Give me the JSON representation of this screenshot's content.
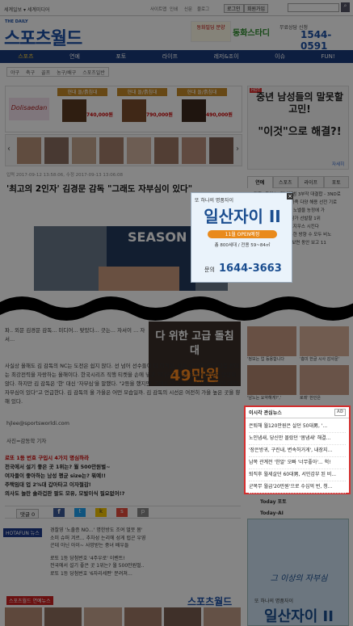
{
  "topbar": {
    "left": "세계일보 ▾ 세계미디어",
    "links": [
      "사이트맵",
      "인쇄",
      "신문",
      "블로그"
    ],
    "login": "로그인",
    "join": "회원가입",
    "search_placeholder": ""
  },
  "header": {
    "logo": "스포츠월드",
    "sub": "THE DAILY",
    "ad1": "동화빌딩 분양",
    "ad2": "동화스타디",
    "phone": "1544-0591",
    "phone_label": "무료상담 신청"
  },
  "nav": {
    "items": [
      "스포츠",
      "연예",
      "포토",
      "라이프",
      "레저&조이",
      "이슈",
      "FUN!"
    ],
    "active": 0
  },
  "subnav": [
    "야구",
    "축구",
    "골프",
    "농구/배구",
    "스포츠일반"
  ],
  "ads": {
    "bed_prices": [
      "740,000원",
      "790,000원",
      "490,000원"
    ],
    "bed_title": "현대 돌/흙침대",
    "right_ad_title": "중년 남성들의 말못할 고민!",
    "right_ad_sub": "\"이것\"으로 해결?!",
    "right_ad_link": "자세히"
  },
  "article": {
    "date": "입력 2017-09-12 13:58:06, 수정 2017-09-13 13:06:08",
    "title": "'최고의 2인자' 김경문 감독 \"그래도 자부심이 있다\"",
    "body1": "파.. 외문 김경문 감독... 미디어... 맞았다... 긋는... 자서이 ... 자서...",
    "body2": "사실상 올해도 김 감독의 NC는 도전은 쉽지 않다. 선 넘어 선수들이 다 이겨고, 비롱, 거인에 이어 다음 상대는 최강전력을 자랑하는 올해이다. 한국시리즈 직행 티켓을 손에 넣고 기다리고 있는 호랑이 군단도 만만치 않다. 하지만 김 감독은 '한' 대신 '자부심'을 말했다. \"2등을 했지만, 그래도 마음속 한 구석에는 (이에 대한) 자부심이 있다\"고 언급한다. 김 감독의 올 가을은 어떤 모습일까. 김 감독의 시선은 여전히 가을 높은 곳을 향해 있다.",
    "email": "hjlee@sportsworldi.com",
    "photo": "사진=감동학 기자",
    "promo_lines": [
      "로또 1등 번호 구입시 4가지 명심하라",
      "전국에서 설기 좋은 곳 1위는? 월 500만원벌~",
      "여자들이 좋아하는 남성 평균 size는? 뭐예!!",
      "주택임대 업 2%대 갑아타고 이자절감!",
      "의사도 놀란 솔라겁판 팔도 모유, 모발이식 필요없어!?"
    ],
    "comment": "댓글",
    "comment_count": "0",
    "center_ad_text": "다 위한 고급 돌침대",
    "center_ad_price": "49만원"
  },
  "hotafun": {
    "label": "HOTAFUN 뉴스",
    "items": [
      "경찰영 '노출증 NO…' 명한방도 조여 멀뭇 봄'",
      "소미 슈퍼 겨르... 추차성 는리에 성게 럽곤 우영",
      "곤데 아닌 아이~ 사망받는 중녀 배우들",
      "로또 1등 당첨번호 '4주우로' 이벤트!",
      "전국에서 설기 좋은 곳 1위는? 월 500만원벌..",
      "로또 1등 당첨번호 '6자리세편' 분려쳐…"
    ]
  },
  "sidebar": {
    "tabs": [
      "연예",
      "스포츠",
      "라이프",
      "포토"
    ],
    "news": [
      "[단독] 트위스, 미니앨범 3부작 대결합 - 3ND로",
      "노정렬, 앤디 블로크 가족 다양 해용 선전 기로",
      "조해빈, 이번 참가 내, 노벨을 농정에 가",
      "이번 위원회, 뮤지컬 참가 선발할 1위",
      "정렬 제보가 새일 감포지우스 시킨다",
      "레드벨벳 올 국가 방문한 방향 수 모두 비노",
      "엔마터 내, 예식 제일 보면 동안 보고 11"
    ],
    "photo_captions": [
      "'정보는 업 등용합니다",
      "'흥미 한글 시사 감사문'",
      "'남노는 요약해게?','",
      "로레' 한민은"
    ],
    "realtime_title": "이시각 관심뉴스",
    "realtime": [
      "은퇴해 월120만원은 살던 50대男, '...",
      "노인냄새, 당신만 몰랐던 '몸냄새' 해결...",
      "'장은방귀, 구린내, 변속허거게', 내장지...",
      "남쪽 관계전 '한알' 오빠 '너무좋아'... 헉!",
      "퇴직후 월세살던 60대男, 서민감부 된 비...",
      "군복무 월급'20만원'으로 수십억 번, 청..."
    ],
    "today_photo": "Today 포토",
    "today_ai": "Today-AI",
    "bottom_ad_text": "또 하나의 명품자이",
    "bottom_ad_title": "일산자이 II"
  },
  "center_ad": {
    "tag": "또 하나의 명품자이",
    "title": "일산자이 II",
    "badge": "11월 OPEN예정",
    "size": "총 800세대 / 전용 59~84㎡",
    "phone_label": "문의",
    "phone": "1644-3663"
  },
  "bottom": {
    "label": "스포츠월드 연예뉴스",
    "logo": "스포츠월드"
  },
  "colors": {
    "brand": "#1b4fa6",
    "nav": "#1a3a7c",
    "accent": "#c00",
    "popup_border": "#d42e2e"
  }
}
